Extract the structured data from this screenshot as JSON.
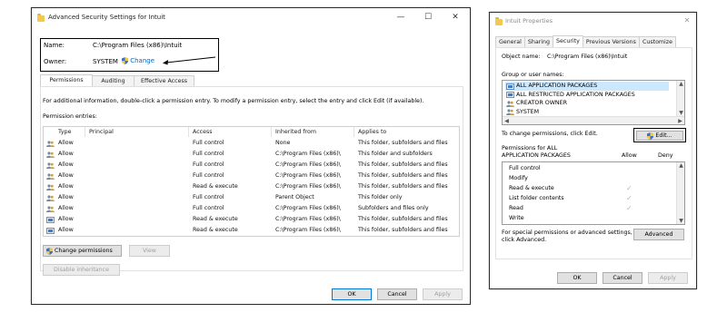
{
  "adv": {
    "title": "Advanced Security Settings for Intuit",
    "name_label": "Name:",
    "name_value": "C:\\Program Files (x86)\\Intuit",
    "owner_label": "Owner:",
    "owner_value": "SYSTEM",
    "change_link": "Change",
    "tabs": [
      {
        "label": "Permissions",
        "active": true
      },
      {
        "label": "Auditing",
        "active": false
      },
      {
        "label": "Effective Access",
        "active": false
      }
    ],
    "info_text": "For additional information, double-click a permission entry. To modify a permission entry, select the entry and click Edit (if available).",
    "entries_label": "Permission entries:",
    "columns": [
      "Type",
      "Principal",
      "Access",
      "Inherited from",
      "Applies to"
    ],
    "rows": [
      {
        "type": "Allow",
        "principal": "",
        "access": "Full control",
        "inherited": "None",
        "applies": "This folder, subfolders and files",
        "icon": "group"
      },
      {
        "type": "Allow",
        "principal": "",
        "access": "Full control",
        "inherited": "C:\\Program Files (x86)\\",
        "applies": "This folder and subfolders",
        "icon": "group"
      },
      {
        "type": "Allow",
        "principal": "",
        "access": "Full control",
        "inherited": "C:\\Program Files (x86)\\",
        "applies": "This folder, subfolders and files",
        "icon": "group"
      },
      {
        "type": "Allow",
        "principal": "",
        "access": "Full control",
        "inherited": "C:\\Program Files (x86)\\",
        "applies": "This folder, subfolders and files",
        "icon": "group"
      },
      {
        "type": "Allow",
        "principal": "",
        "access": "Read & execute",
        "inherited": "C:\\Program Files (x86)\\",
        "applies": "This folder, subfolders and files",
        "icon": "group"
      },
      {
        "type": "Allow",
        "principal": "",
        "access": "Full control",
        "inherited": "Parent Object",
        "applies": "This folder only",
        "icon": "group"
      },
      {
        "type": "Allow",
        "principal": "",
        "access": "Full control",
        "inherited": "C:\\Program Files (x86)\\",
        "applies": "Subfolders and files only",
        "icon": "group"
      },
      {
        "type": "Allow",
        "principal": "",
        "access": "Read & execute",
        "inherited": "C:\\Program Files (x86)\\",
        "applies": "This folder, subfolders and files",
        "icon": "package"
      },
      {
        "type": "Allow",
        "principal": "",
        "access": "Read & execute",
        "inherited": "C:\\Program Files (x86)\\",
        "applies": "This folder, subfolders and files",
        "icon": "package"
      }
    ],
    "change_permissions": "Change permissions",
    "view": "View",
    "disable_inheritance": "Disable inheritance",
    "ok": "OK",
    "cancel": "Cancel",
    "apply": "Apply"
  },
  "props": {
    "title": "Intuit Properties",
    "tabs": [
      {
        "label": "General",
        "active": false
      },
      {
        "label": "Sharing",
        "active": false
      },
      {
        "label": "Security",
        "active": true
      },
      {
        "label": "Previous Versions",
        "active": false
      },
      {
        "label": "Customize",
        "active": false
      }
    ],
    "object_label": "Object name:",
    "object_value": "C:\\Program Files (x86)\\Intuit",
    "group_label": "Group or user names:",
    "groups": [
      {
        "name": "ALL APPLICATION PACKAGES",
        "icon": "package"
      },
      {
        "name": "ALL RESTRICTED APPLICATION PACKAGES",
        "icon": "package"
      },
      {
        "name": "CREATOR OWNER",
        "icon": "group"
      },
      {
        "name": "SYSTEM",
        "icon": "group"
      }
    ],
    "change_text": "To change permissions, click Edit.",
    "edit": "Edit...",
    "perm_label_1": "Permissions for ALL",
    "perm_label_2": "APPLICATION PACKAGES",
    "allow": "Allow",
    "deny": "Deny",
    "permissions": [
      {
        "name": "Full control",
        "allow": false
      },
      {
        "name": "Modify",
        "allow": false
      },
      {
        "name": "Read & execute",
        "allow": true
      },
      {
        "name": "List folder contents",
        "allow": true
      },
      {
        "name": "Read",
        "allow": true
      },
      {
        "name": "Write",
        "allow": false
      }
    ],
    "special_text_1": "For special permissions or advanced settings,",
    "special_text_2": "click Advanced.",
    "advanced": "Advanced",
    "ok": "OK",
    "cancel": "Cancel",
    "apply": "Apply"
  },
  "colors": {
    "link": "#0066cc",
    "selection": "#cce8ff",
    "accent": "#0078d7"
  }
}
